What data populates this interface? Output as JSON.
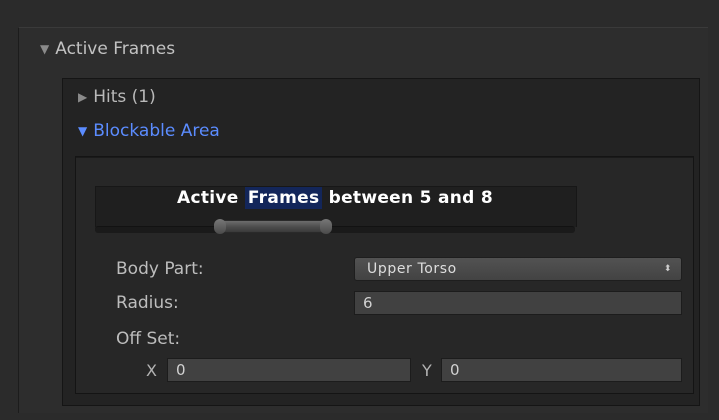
{
  "section": {
    "title": "Active Frames",
    "expanded": true
  },
  "folds": {
    "hits": {
      "label": "Hits (1)",
      "expanded": false
    },
    "blockable": {
      "label": "Blockable Area",
      "expanded": true
    }
  },
  "range": {
    "prefix": "Active ",
    "highlight": "Frames",
    "suffix": " between 5 and 8",
    "min": 5,
    "max": 8
  },
  "properties": {
    "body_part": {
      "label": "Body Part:",
      "value": "Upper Torso"
    },
    "radius": {
      "label": "Radius:",
      "value": "6"
    },
    "offset": {
      "label": "Off Set:",
      "x_label": "X",
      "x_value": "0",
      "y_label": "Y",
      "y_value": "0"
    }
  },
  "icons": {
    "expanded": "▼",
    "collapsed": "▶",
    "dropdown": "⬍"
  },
  "colors": {
    "accent": "#5b8cff",
    "highlight": "#13265a",
    "background": "#2b2b2b"
  }
}
